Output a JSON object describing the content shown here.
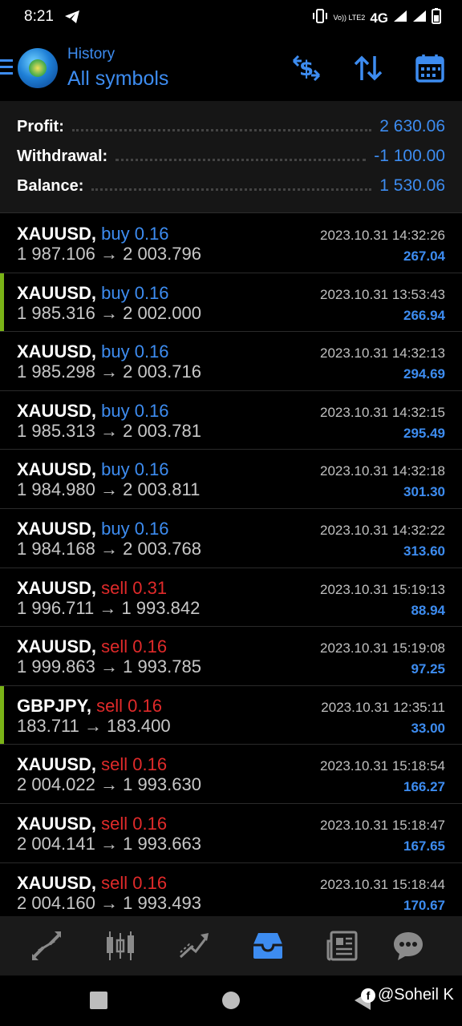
{
  "status_bar": {
    "time": "8:21",
    "network": "4G",
    "volte": "Vo)) LTE2"
  },
  "header": {
    "subtitle": "History",
    "title": "All symbols"
  },
  "summary": {
    "profit_label": "Profit:",
    "profit_value": "2 630.06",
    "withdrawal_label": "Withdrawal:",
    "withdrawal_value": "-1 100.00",
    "balance_label": "Balance:",
    "balance_value": "1 530.06"
  },
  "trades": [
    {
      "symbol": "XAUUSD,",
      "side": "buy 0.16",
      "type": "buy",
      "prices": "1 987.106 → 2 003.796",
      "time": "2023.10.31 14:32:26",
      "profit": "267.04",
      "accent": false
    },
    {
      "symbol": "XAUUSD,",
      "side": "buy 0.16",
      "type": "buy",
      "prices": "1 985.316 → 2 002.000",
      "time": "2023.10.31 13:53:43",
      "profit": "266.94",
      "accent": true
    },
    {
      "symbol": "XAUUSD,",
      "side": "buy 0.16",
      "type": "buy",
      "prices": "1 985.298 → 2 003.716",
      "time": "2023.10.31 14:32:13",
      "profit": "294.69",
      "accent": false
    },
    {
      "symbol": "XAUUSD,",
      "side": "buy 0.16",
      "type": "buy",
      "prices": "1 985.313 → 2 003.781",
      "time": "2023.10.31 14:32:15",
      "profit": "295.49",
      "accent": false
    },
    {
      "symbol": "XAUUSD,",
      "side": "buy 0.16",
      "type": "buy",
      "prices": "1 984.980 → 2 003.811",
      "time": "2023.10.31 14:32:18",
      "profit": "301.30",
      "accent": false
    },
    {
      "symbol": "XAUUSD,",
      "side": "buy 0.16",
      "type": "buy",
      "prices": "1 984.168 → 2 003.768",
      "time": "2023.10.31 14:32:22",
      "profit": "313.60",
      "accent": false
    },
    {
      "symbol": "XAUUSD,",
      "side": "sell 0.31",
      "type": "sell",
      "prices": "1 996.711 → 1 993.842",
      "time": "2023.10.31 15:19:13",
      "profit": "88.94",
      "accent": false
    },
    {
      "symbol": "XAUUSD,",
      "side": "sell 0.16",
      "type": "sell",
      "prices": "1 999.863 → 1 993.785",
      "time": "2023.10.31 15:19:08",
      "profit": "97.25",
      "accent": false
    },
    {
      "symbol": "GBPJPY,",
      "side": "sell 0.16",
      "type": "sell",
      "prices": "183.711 → 183.400",
      "time": "2023.10.31 12:35:11",
      "profit": "33.00",
      "accent": true
    },
    {
      "symbol": "XAUUSD,",
      "side": "sell 0.16",
      "type": "sell",
      "prices": "2 004.022 → 1 993.630",
      "time": "2023.10.31 15:18:54",
      "profit": "166.27",
      "accent": false
    },
    {
      "symbol": "XAUUSD,",
      "side": "sell 0.16",
      "type": "sell",
      "prices": "2 004.141 → 1 993.663",
      "time": "2023.10.31 15:18:47",
      "profit": "167.65",
      "accent": false
    },
    {
      "symbol": "XAUUSD,",
      "side": "sell 0.16",
      "type": "sell",
      "prices": "2 004.160 → 1 993.493",
      "time": "2023.10.31 15:18:44",
      "profit": "170.67",
      "accent": false
    }
  ],
  "bottom_nav": [
    {
      "icon": "quotes-icon",
      "active": false
    },
    {
      "icon": "chart-icon",
      "active": false
    },
    {
      "icon": "trade-icon",
      "active": false
    },
    {
      "icon": "history-icon",
      "active": true
    },
    {
      "icon": "news-icon",
      "active": false
    },
    {
      "icon": "chat-icon",
      "active": false
    }
  ],
  "watermark": "@Soheil K",
  "colors": {
    "accent_blue": "#3d8cf0",
    "sell_red": "#e02a2a",
    "accent_green": "#7ab317",
    "inactive_icon": "#8a8a8a"
  }
}
